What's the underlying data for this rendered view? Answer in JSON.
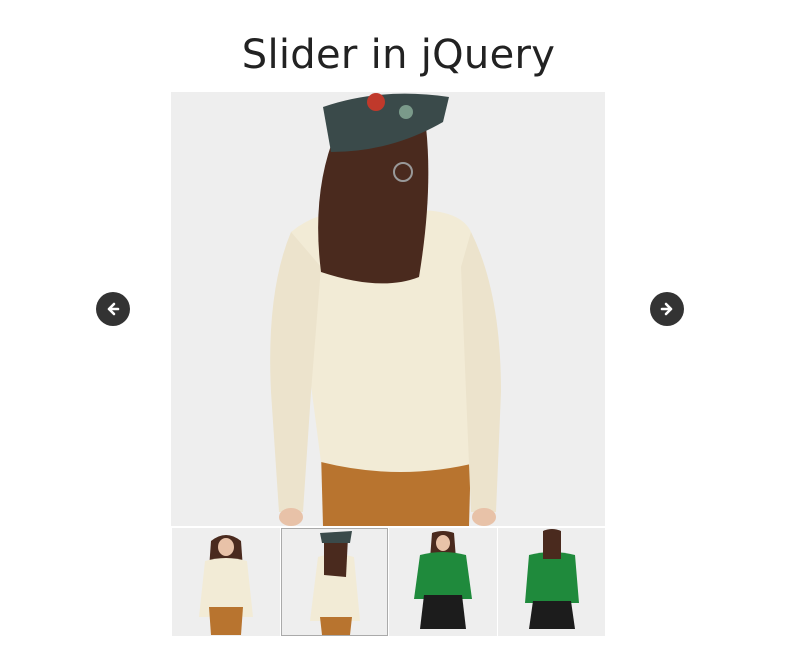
{
  "page": {
    "title": "Slider in jQuery"
  },
  "slider": {
    "active_index": 1,
    "slides": [
      {
        "name": "cream-sweater-front"
      },
      {
        "name": "cream-sweater-back"
      },
      {
        "name": "green-sweater-front"
      },
      {
        "name": "green-sweater-back"
      }
    ],
    "prev_icon": "arrow-left-circle-icon",
    "next_icon": "arrow-right-circle-icon"
  },
  "colors": {
    "background": "#ffffff",
    "photo_bg": "#eeeeee",
    "arrow_bg": "#333333",
    "cream_sweater": "#f2ebd6",
    "green_sweater": "#1f8a3c",
    "hair": "#4a2a1e",
    "pants": "#b8742f",
    "skirt": "#1c1c1c"
  }
}
